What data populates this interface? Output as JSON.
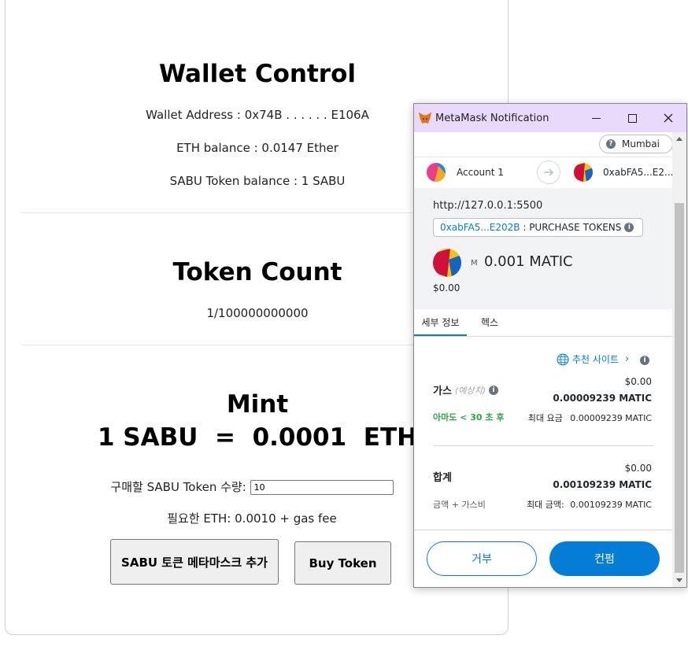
{
  "dapp": {
    "wallet_title": "Wallet Control",
    "wallet_address": "Wallet Address : 0x74B . . . . . . E106A",
    "eth_balance": "ETH balance : 0.0147 Ether",
    "sabu_balance": "SABU Token balance : 1 SABU",
    "token_count_title": "Token Count",
    "token_count": "1/100000000000",
    "mint_title": "Mint",
    "mint_rate": "1 SABU  =  0.0001  ETH",
    "qty_label": "구매할 SABU Token 수량:",
    "qty_value": "10",
    "required_eth": "필요한 ETH: 0.0010 + gas fee",
    "add_metamask_button": "SABU 토큰 메타마스크 추가",
    "buy_button": "Buy Token"
  },
  "metamask": {
    "window_title": "MetaMask Notification",
    "network": "Mumbai",
    "from_account": "Account 1",
    "to_account": "0xabFA5...E2...",
    "origin": "http://127.0.0.1:5500",
    "contract_address": "0xabFA5...E202B",
    "contract_method": " : PURCHASE TOKENS",
    "amount_symbol": "M",
    "amount": "0.001 MATIC",
    "amount_fiat": "$0.00",
    "tabs": [
      "세부 정보",
      "헥스"
    ],
    "recommended_site": "추천 사이트",
    "gas": {
      "label": "가스",
      "estimated": "(예상치)",
      "fiat": "$0.00",
      "value": "0.00009239 MATIC",
      "speed": "아마도 < 30 초 후",
      "max_fee_label": "최대 요금",
      "max_fee_value": "0.00009239 MATIC"
    },
    "total": {
      "label": "합계",
      "fiat": "$0.00",
      "value": "0.00109239 MATIC",
      "sub_label": "금액 + 가스비",
      "max_label": "최대 금액:",
      "max_value": "0.00109239 MATIC"
    },
    "reject_button": "거부",
    "confirm_button": "컨펌",
    "colors": {
      "accent": "#037dd6",
      "titlebar": "#e9d9fb",
      "success": "#28a745"
    }
  }
}
